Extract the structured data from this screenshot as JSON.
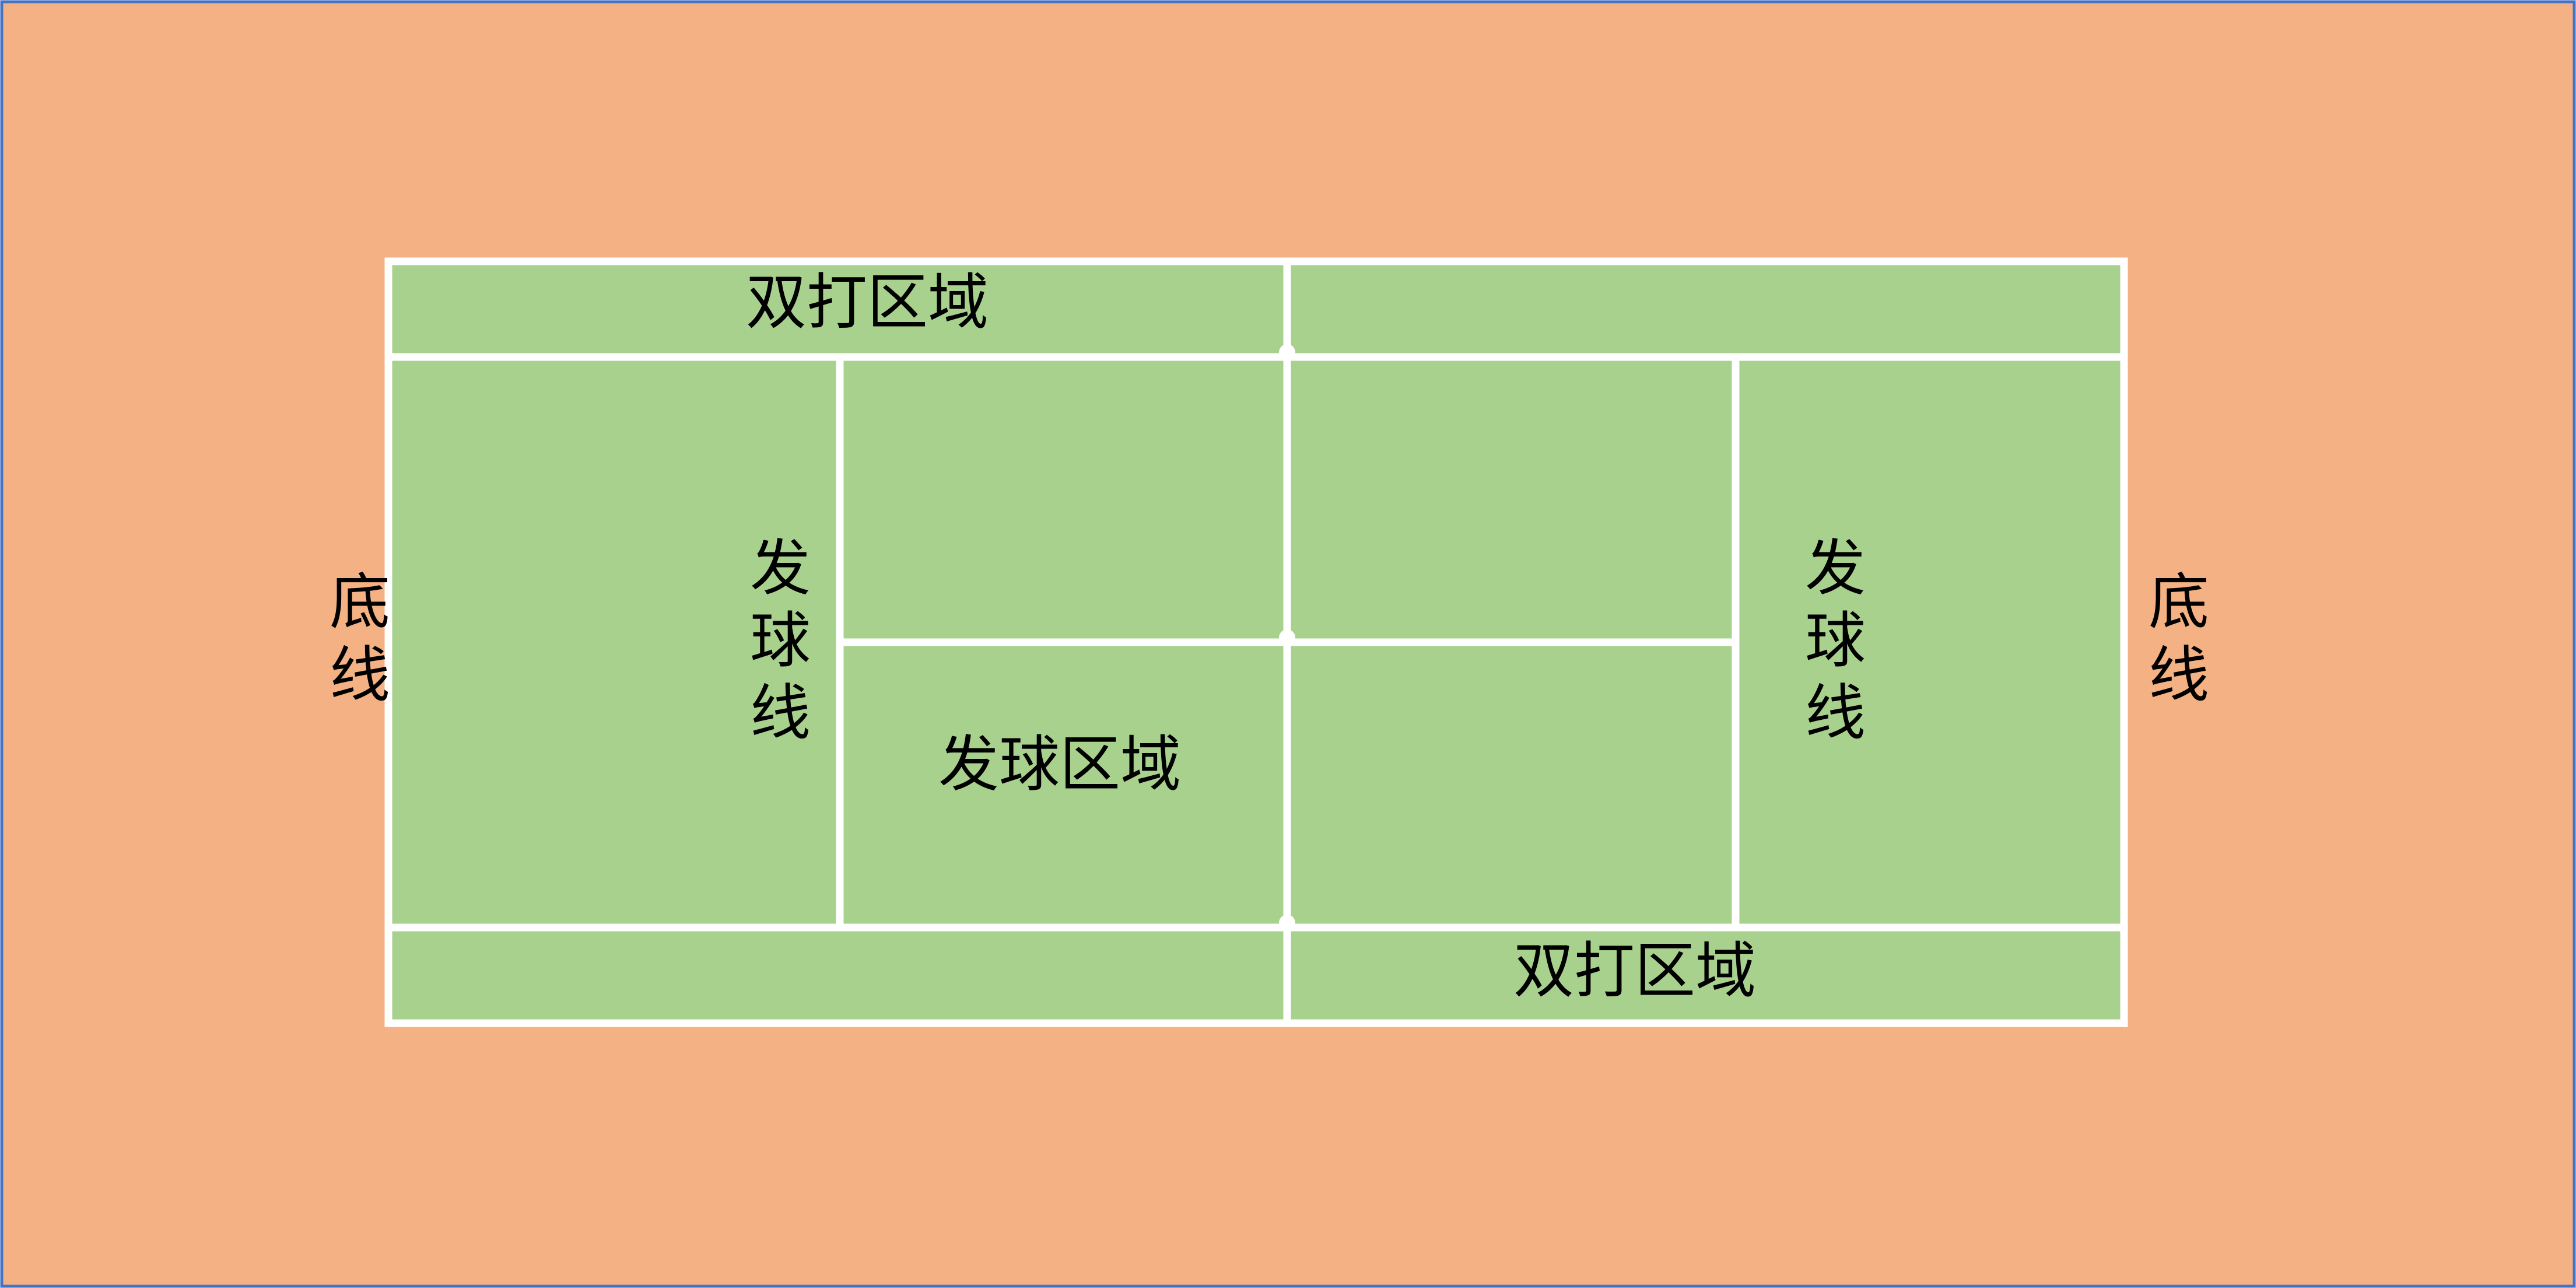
{
  "colors": {
    "surround": "#F4B183",
    "border": "#4472C4",
    "court": "#A9D18E",
    "lines": "#FFFFFF",
    "text": "#000000"
  },
  "labels": {
    "doubles_area_top": "双打区域",
    "doubles_area_bottom": "双打区域",
    "service_area": "发球区域",
    "baseline_left": [
      "底",
      "线"
    ],
    "baseline_right": [
      "底",
      "线"
    ],
    "service_line_left": [
      "发",
      "球",
      "线"
    ],
    "service_line_right": [
      "发",
      "球",
      "线"
    ]
  }
}
